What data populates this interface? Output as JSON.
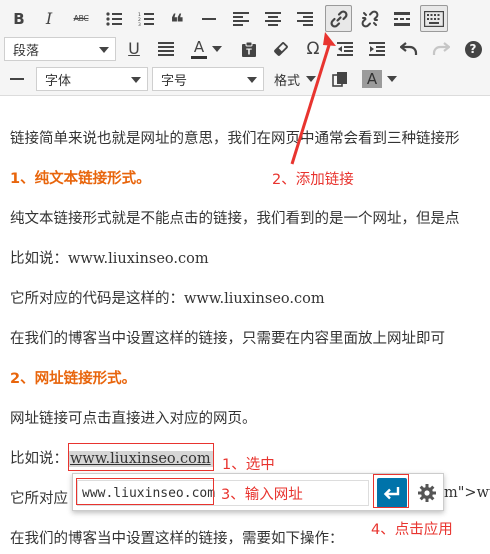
{
  "toolbar": {
    "row1": {
      "bold": "B",
      "italic": "I",
      "strike": "ABC",
      "blockquote": "❝"
    },
    "row2": {
      "format_select": "段落",
      "underline": "U",
      "text_color": "A",
      "special_char": "Ω",
      "help": "?"
    },
    "row3": {
      "font_family_select": "字体",
      "font_size_select": "字号",
      "formats_menu": "格式",
      "bg_color": "A"
    }
  },
  "content": {
    "p1": "链接简单来说也就是网址的意思，我们在网页中通常会看到三种链接形",
    "h1": "1、纯文本链接形式。",
    "p2": "纯文本链接形式就是不能点击的链接，我们看到的是一个网址，但是点",
    "p3": "比如说：www.liuxinseo.com",
    "p4": "它所对应的代码是这样的：www.liuxinseo.com",
    "p5": "在我们的博客当中设置这样的链接，只需要在内容里面放上网址即可",
    "h2": "2、网址链接形式。",
    "p6": "网址链接可点击直接进入对应的网页。",
    "p7_prefix": "比如说：",
    "p7_url": "www.liuxinseo.com",
    "p8_prefix": "它所对应",
    "p8_suffix": "m\">ww",
    "p9": "在我们的博客当中设置这样的链接，需要如下操作："
  },
  "link_popup": {
    "url_value": "www.liuxinseo.com"
  },
  "annotations": {
    "step1": "1、选中",
    "step2": "2、添加链接",
    "step3": "3、输入网址",
    "step4": "4、点击应用"
  },
  "colors": {
    "heading": "#e8650c",
    "annotation": "#e8342f",
    "apply_button": "#0073aa"
  }
}
